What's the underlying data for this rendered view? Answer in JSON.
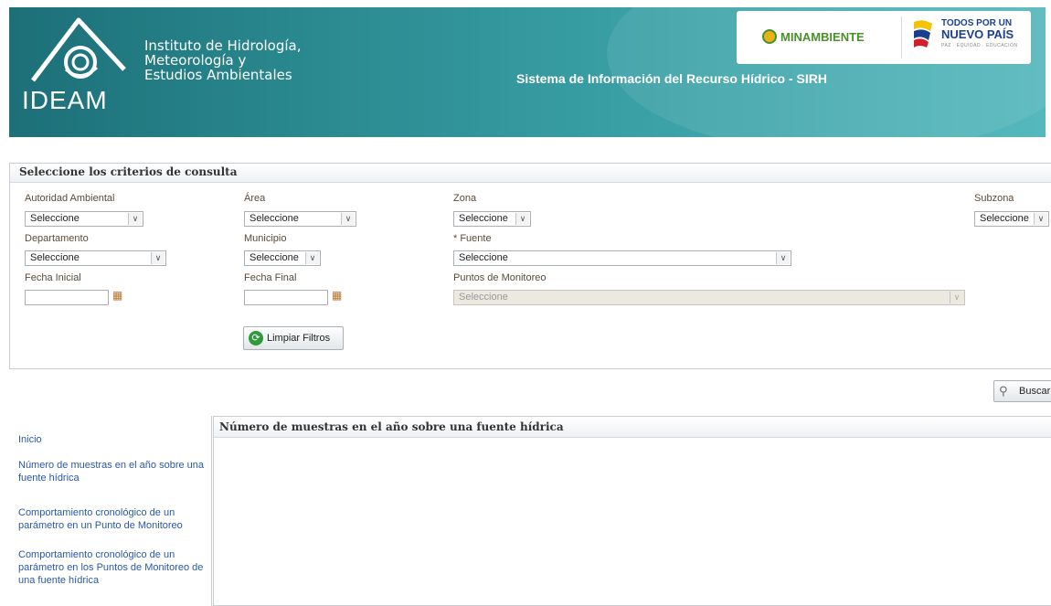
{
  "header": {
    "logo_text": "IDEAM",
    "institute_lines": [
      "Instituto de Hidrología,",
      "Meteorología y",
      "Estudios Ambientales"
    ],
    "system_title": "Sistema de Información del Recurso Hídrico - SIRH",
    "brand_ministry": "MINAMBIENTE",
    "brand_gov_line1": "TODOS POR UN",
    "brand_gov_line2": "NUEVO PAÍS",
    "brand_gov_line3": "PAZ · EQUIDAD · EDUCACIÓN"
  },
  "criteria": {
    "title": "Seleccione los criterios de consulta",
    "fields": {
      "autoridad": {
        "label": "Autoridad Ambiental",
        "value": "Seleccione"
      },
      "area": {
        "label": "Área",
        "value": "Seleccione"
      },
      "zona": {
        "label": "Zona",
        "value": "Seleccione"
      },
      "subzona": {
        "label": "Subzona",
        "value": "Seleccione"
      },
      "departamento": {
        "label": "Departamento",
        "value": "Seleccione"
      },
      "municipio": {
        "label": "Municipio",
        "value": "Seleccione"
      },
      "fuente": {
        "label": "* Fuente",
        "value": "Seleccione"
      },
      "fecha_inicial": {
        "label": "Fecha Inicial",
        "value": ""
      },
      "fecha_final": {
        "label": "Fecha Final",
        "value": ""
      },
      "puntos": {
        "label": "Puntos de Monitoreo",
        "value": "Seleccione"
      }
    },
    "clear_button": "Limpiar Filtros",
    "search_button": "Buscar"
  },
  "nav": {
    "items": [
      "Inicio",
      "Número de muestras en el año sobre una fuente hídrica",
      "Comportamiento cronológico de un parámetro en un Punto de Monitoreo",
      "Comportamiento cronológico de un parámetro en los Puntos de Monitoreo de una fuente hídrica"
    ]
  },
  "report": {
    "title": "Número de muestras en el año sobre una fuente hídrica"
  },
  "colors": {
    "header_teal": "#2a8a90",
    "link_blue": "#2a58a8",
    "brand_green": "#4a8f2a",
    "brand_blue": "#1b3f8f"
  }
}
